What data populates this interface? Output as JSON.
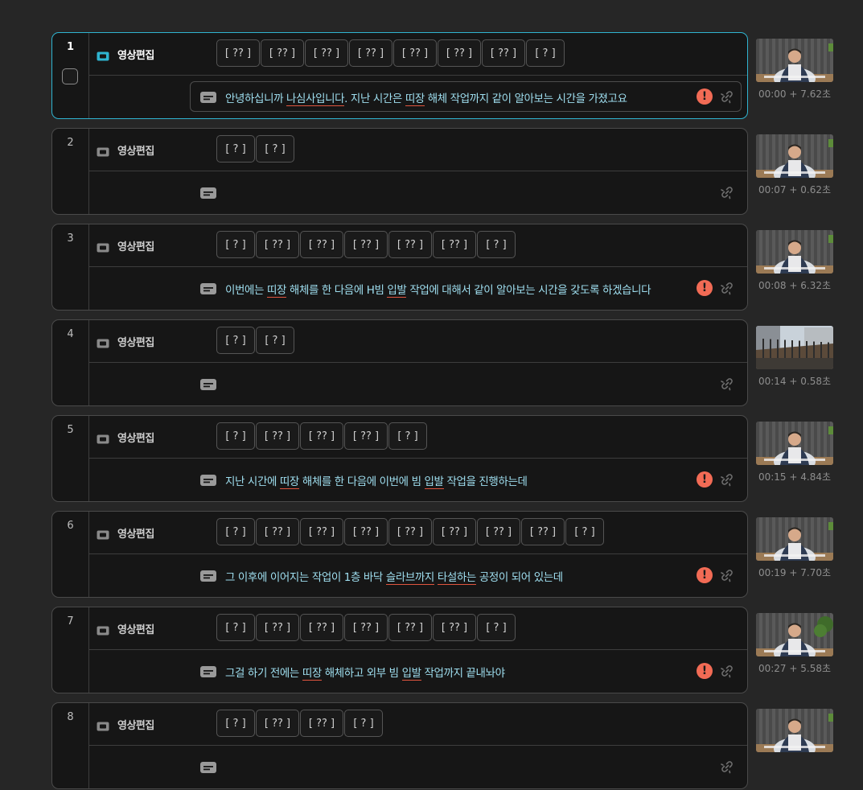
{
  "track_label": "영상편집",
  "clips": [
    {
      "number": "1",
      "active": true,
      "tokens": [
        "[ ?? ]",
        "[ ?? ]",
        "[ ?? ]",
        "[ ?? ]",
        "[ ?? ]",
        "[ ?? ]",
        "[ ?? ]",
        "[ ? ]"
      ],
      "subtitle": [
        {
          "t": "안녕하십니까 "
        },
        {
          "t": "나심사입니다",
          "u": true
        },
        {
          "t": ". 지난 시간은 "
        },
        {
          "t": "띠장",
          "u": true
        },
        {
          "t": " 해체 작업까지 같이 알아보는 시간을 가졌고요"
        }
      ],
      "warning": true,
      "time": "00:00 + 7.62초",
      "thumb": "person"
    },
    {
      "number": "2",
      "tokens": [
        "[ ? ]",
        "[ ? ]"
      ],
      "subtitle": [],
      "warning": false,
      "time": "00:07 + 0.62초",
      "thumb": "person"
    },
    {
      "number": "3",
      "tokens": [
        "[ ? ]",
        "[ ?? ]",
        "[ ?? ]",
        "[ ?? ]",
        "[ ?? ]",
        "[ ?? ]",
        "[ ? ]"
      ],
      "subtitle": [
        {
          "t": "이번에는 "
        },
        {
          "t": "띠장",
          "u": true
        },
        {
          "t": " 해체를 한 다음에 H빔 "
        },
        {
          "t": "입발",
          "u": true
        },
        {
          "t": " 작업에 대해서 같이 알아보는 시간을 갖도록 하겠습니다"
        }
      ],
      "warning": true,
      "time": "00:08 + 6.32초",
      "thumb": "person"
    },
    {
      "number": "4",
      "tokens": [
        "[ ? ]",
        "[ ? ]"
      ],
      "subtitle": [],
      "warning": false,
      "time": "00:14 + 0.58초",
      "thumb": "site"
    },
    {
      "number": "5",
      "tokens": [
        "[ ? ]",
        "[ ?? ]",
        "[ ?? ]",
        "[ ?? ]",
        "[ ? ]"
      ],
      "subtitle": [
        {
          "t": "지난 시간에 "
        },
        {
          "t": "띠장",
          "u": true
        },
        {
          "t": " 해체를 한 다음에 이번에 빔 "
        },
        {
          "t": "입발",
          "u": true
        },
        {
          "t": " 작업을 진행하는데"
        }
      ],
      "warning": true,
      "time": "00:15 + 4.84초",
      "thumb": "person"
    },
    {
      "number": "6",
      "tokens": [
        "[ ? ]",
        "[ ?? ]",
        "[ ?? ]",
        "[ ?? ]",
        "[ ?? ]",
        "[ ?? ]",
        "[ ?? ]",
        "[ ?? ]",
        "[ ? ]"
      ],
      "subtitle": [
        {
          "t": "그 이후에 이어지는 작업이 1층 바닥 "
        },
        {
          "t": "슬라브까지",
          "u": true
        },
        {
          "t": " "
        },
        {
          "t": "타설하는",
          "u": true
        },
        {
          "t": " 공정이 되어 있는데"
        }
      ],
      "warning": true,
      "time": "00:19 + 7.70초",
      "thumb": "person"
    },
    {
      "number": "7",
      "tokens": [
        "[ ? ]",
        "[ ?? ]",
        "[ ?? ]",
        "[ ?? ]",
        "[ ?? ]",
        "[ ?? ]",
        "[ ? ]"
      ],
      "subtitle": [
        {
          "t": "그걸 하기 전에는 "
        },
        {
          "t": "띠장",
          "u": true
        },
        {
          "t": " 해체하고 외부 빔 "
        },
        {
          "t": "입발",
          "u": true
        },
        {
          "t": " 작업까지 끝내놔야"
        }
      ],
      "warning": true,
      "time": "00:27 + 5.58초",
      "thumb": "person2"
    },
    {
      "number": "8",
      "tokens": [
        "[ ? ]",
        "[ ?? ]",
        "[ ?? ]",
        "[ ? ]"
      ],
      "subtitle": [],
      "warning": false,
      "time": "",
      "thumb": "person"
    }
  ],
  "colors": {
    "accent": "#2fb4d0",
    "warning": "#f26b55",
    "subtitle_text": "#9fdff0",
    "underline": "#e0553f"
  }
}
